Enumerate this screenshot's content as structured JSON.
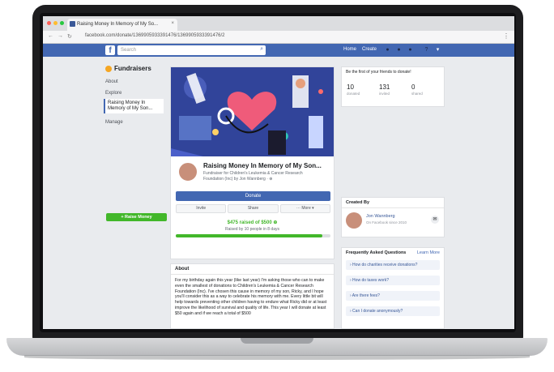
{
  "browser": {
    "tab_title": "Raising Money In Memory of My So...",
    "tab_close": "×",
    "url": "facebook.com/donate/1369905933391476/1369905933391476/2",
    "nav_back": "←",
    "nav_fwd": "→",
    "nav_reload": "↻",
    "menu": "⋮"
  },
  "header": {
    "logo": "f",
    "search_placeholder": "Search",
    "home": "Home",
    "create": "Create"
  },
  "sidebar": {
    "title": "Fundraisers",
    "items": [
      "About",
      "Explore",
      "Manage"
    ],
    "selected": "Raising Money In Memory of My Son...",
    "raise_button": "+ Raise Money"
  },
  "fundraiser": {
    "title": "Raising Money In Memory of My Son...",
    "subtitle": "Fundraiser for Children's Leukemia & Cancer Research Foundation (Inc) by Jon Wannberg · ⊕",
    "donate_label": "Donate",
    "invite_label": "Invite",
    "share_label": "Share",
    "more_label": "··· More ▾",
    "raised_text": "$475 raised of $500 ⊕",
    "raised_by": "Raised by 10 people in 8 days",
    "progress": 0.95
  },
  "about": {
    "heading": "About",
    "text": "For my birthday again this year (like last year) I'm asking those who can to make even the smallest of donations to Children's Leukemia & Cancer Research Foundation (Inc). I've chosen this cause in memory of my son, Ricky, and I hope you'll consider this as a way to celebrate his memory with me. Every little bit will help towards preventing other children having to endure what Ricky did or at least improve the likelihood of survival and quality of life. This year I will donate at least $50 again and if we reach a total of $500"
  },
  "friends_card": {
    "heading": "Be the first of your friends to donate!",
    "stats": [
      {
        "value": "10",
        "label": "donated"
      },
      {
        "value": "131",
        "label": "invited"
      },
      {
        "value": "0",
        "label": "shared"
      }
    ]
  },
  "created_by": {
    "heading": "Created By",
    "name": "Jon Wannberg",
    "since": "On Facebook since 2010"
  },
  "faq": {
    "heading": "Frequently Asked Questions",
    "learn_more": "Learn More",
    "items": [
      "› How do charities receive donations?",
      "› How do taxes work?",
      "› Are there fees?",
      "› Can I donate anonymously?"
    ]
  },
  "colors": {
    "facebook_blue": "#4267b2",
    "green": "#42b72a",
    "cover_bg": "#31449a",
    "heart": "#ef5b7a"
  }
}
